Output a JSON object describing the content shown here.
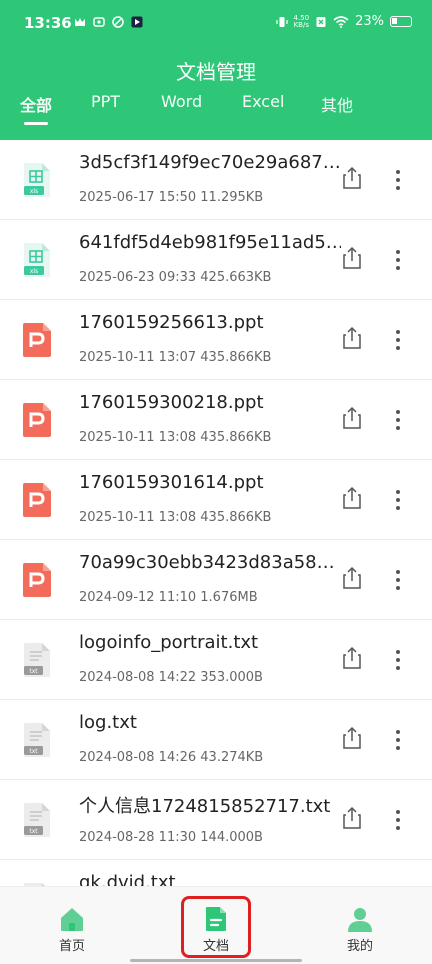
{
  "status": {
    "time": "13:36",
    "net_speed_value": "4.50",
    "net_speed_unit": "KB/s",
    "battery": "23%"
  },
  "header": {
    "title": "文档管理"
  },
  "tabs": [
    {
      "label": "全部",
      "active": true
    },
    {
      "label": "PPT"
    },
    {
      "label": "Word"
    },
    {
      "label": "Excel"
    },
    {
      "label": "其他"
    }
  ],
  "files": [
    {
      "name": "3d5cf3f149f9ec70e29a687…",
      "meta": "2025-06-17 15:50 11.295KB",
      "type": "xls",
      "type_label": "xls"
    },
    {
      "name": "641fdf5d4eb981f95e11ad5…",
      "meta": "2025-06-23 09:33 425.663KB",
      "type": "xls",
      "type_label": "xls"
    },
    {
      "name": "1760159256613.ppt",
      "meta": "2025-10-11 13:07 435.866KB",
      "type": "ppt"
    },
    {
      "name": "1760159300218.ppt",
      "meta": "2025-10-11 13:08 435.866KB",
      "type": "ppt"
    },
    {
      "name": "1760159301614.ppt",
      "meta": "2025-10-11 13:08 435.866KB",
      "type": "ppt"
    },
    {
      "name": "70a99c30ebb3423d83a58…",
      "meta": "2024-09-12 11:10 1.676MB",
      "type": "ppt"
    },
    {
      "name": "logoinfo_portrait.txt",
      "meta": "2024-08-08 14:22 353.000B",
      "type": "txt",
      "type_label": "txt"
    },
    {
      "name": "log.txt",
      "meta": "2024-08-08 14:26 43.274KB",
      "type": "txt",
      "type_label": "txt"
    },
    {
      "name": "个人信息1724815852717.txt",
      "meta": "2024-08-28 11:30 144.000B",
      "type": "txt",
      "type_label": "txt"
    },
    {
      "name": "qk.dvid.txt",
      "meta": "",
      "type": "txt",
      "type_label": "txt"
    }
  ],
  "nav": [
    {
      "label": "首页",
      "icon": "home-icon"
    },
    {
      "label": "文档",
      "icon": "document-icon",
      "active": true
    },
    {
      "label": "我的",
      "icon": "profile-icon"
    }
  ],
  "colors": {
    "brand": "#2ec778",
    "ppt": "#f26b5b",
    "xls": "#3cc9a0",
    "highlight": "#e02020"
  }
}
